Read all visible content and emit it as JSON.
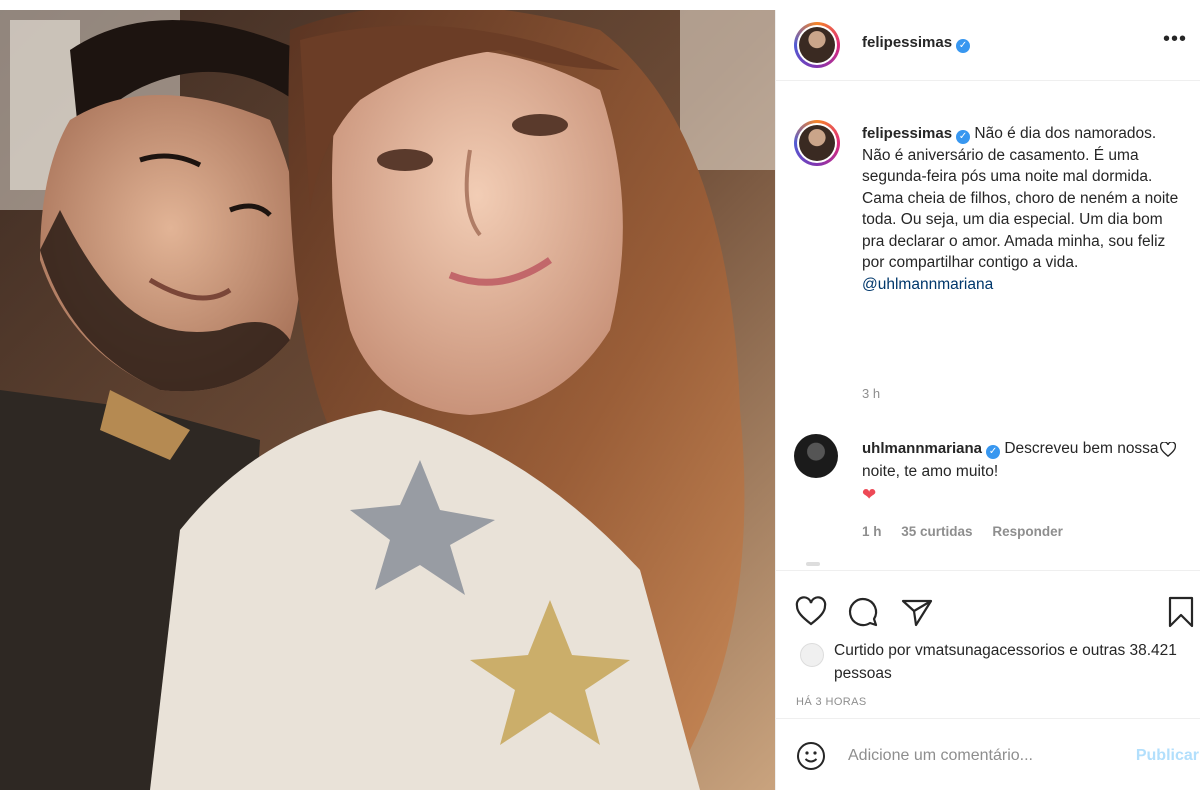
{
  "post": {
    "author": "felipessimas",
    "verified_icon": "verified-badge-icon",
    "more_icon": "more-options-icon",
    "photo_description_icon": "photo"
  },
  "caption": {
    "author": "felipessimas",
    "text": "Não é dia dos namorados. Não é aniversário de casamento. É uma segunda-feira pós uma noite mal dormida. Cama cheia de filhos, choro de neném a noite toda. Ou seja, um dia especial. Um dia bom pra declarar o amor. Amada minha, sou feliz por compartilhar contigo a vida.",
    "mention": "@uhlmannmariana",
    "time": "3 h"
  },
  "comments": [
    {
      "author": "uhlmannmariana",
      "text": "Descreveu bem nossa noite, te amo muito!",
      "emoji": "❤",
      "time": "1 h",
      "likes": "35 curtidas",
      "reply": "Responder"
    }
  ],
  "actions": {
    "like_icon": "heart-icon",
    "comment_icon": "comment-icon",
    "share_icon": "share-icon",
    "save_icon": "bookmark-icon"
  },
  "likes": {
    "text": "Curtido por vmatsunagacessorios e outras 38.421 pessoas"
  },
  "timestamp": "HÁ 3 HORAS",
  "add_comment": {
    "placeholder": "Adicione um comentário...",
    "publish_label": "Publicar",
    "emoji_icon": "emoji-icon"
  },
  "colors": {
    "verified": "#3897f0",
    "mention": "#00376b",
    "publish_disabled": "#b2dffc",
    "heart_red": "#ed4956"
  }
}
